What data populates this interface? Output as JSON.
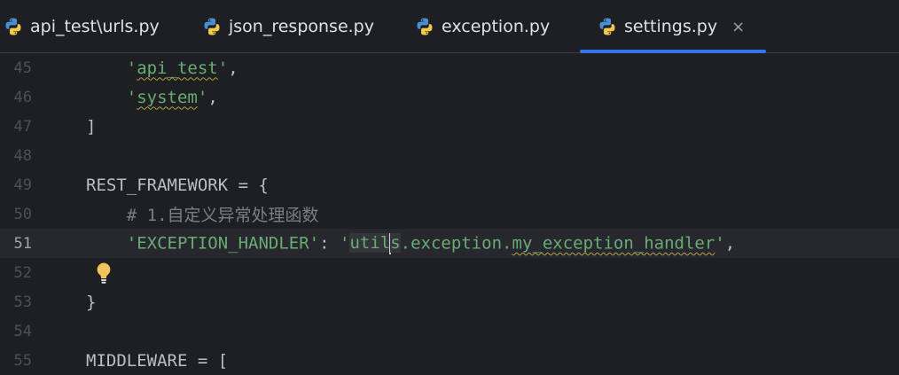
{
  "tabs": [
    {
      "label": "api_test\\urls.py"
    },
    {
      "label": "json_response.py"
    },
    {
      "label": "exception.py"
    },
    {
      "label": "settings.py",
      "active": true,
      "close": "×"
    }
  ],
  "colors": {
    "background": "#1e1f22",
    "string": "#6aab73",
    "comment": "#7a7e85",
    "text": "#bcbec4",
    "accent": "#3574f0"
  },
  "editor": {
    "current_line": "51",
    "lines": [
      {
        "num": "45",
        "q1": "'",
        "text": "api_test",
        "q2": "'",
        "rest": ","
      },
      {
        "num": "46",
        "q1": "'",
        "text": "system",
        "q2": "'",
        "rest": ","
      },
      {
        "num": "47",
        "text": "]"
      },
      {
        "num": "48",
        "text": ""
      },
      {
        "num": "49",
        "text": "REST_FRAMEWORK = {"
      },
      {
        "num": "50",
        "text": "# 1.自定义异常处理函数"
      },
      {
        "num": "51",
        "key": "'EXCEPTION_HANDLER'",
        "colon": ": ",
        "q1": "'",
        "v1": "util",
        "v2": "s",
        "v3": ".exception.",
        "v4": "my_exception_handler",
        "q2": "'",
        "rest": ","
      },
      {
        "num": "52",
        "icon": "lightbulb-icon"
      },
      {
        "num": "53",
        "text": "}"
      },
      {
        "num": "54",
        "text": ""
      },
      {
        "num": "55",
        "text": "MIDDLEWARE = ["
      }
    ]
  }
}
